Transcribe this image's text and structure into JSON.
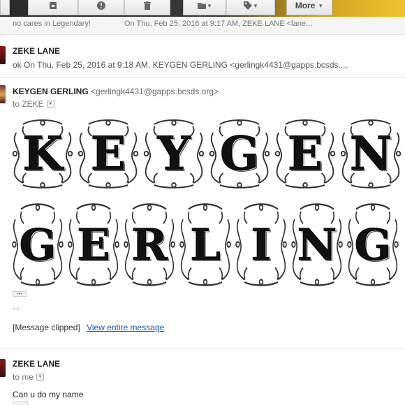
{
  "toolbar": {
    "more_label": "More",
    "icons": [
      "archive-icon",
      "spam-icon",
      "trash-icon",
      "folder-icon",
      "label-icon"
    ]
  },
  "collapsed": {
    "left_text": "no cares in Legendary!",
    "right_text": "On Thu, Feb 25, 2016 at 9:17 AM, ZEKE LANE <lane..."
  },
  "message1": {
    "sender": "ZEKE LANE",
    "snippet": "ok On Thu, Feb 25, 2016 at 9:18 AM, KEYGEN GERLING <gerlingk4431@gapps.bcsds...."
  },
  "message2": {
    "sender": "KEYGEN GERLING",
    "sender_email": "<gerlingk4431@gapps.bcsds.org>",
    "to": "to ZEKE",
    "ornament_line1": [
      "K",
      "E",
      "Y",
      "G",
      "E",
      "N"
    ],
    "ornament_line2": [
      "G",
      "E",
      "R",
      "L",
      "I",
      "N",
      "G"
    ],
    "dots": "•••",
    "ellipsis": "...",
    "clipped_label": "[Message clipped]",
    "view_link": "View entire message"
  },
  "message3": {
    "sender": "ZEKE LANE",
    "to": "to me",
    "body": "Can u do my name"
  }
}
